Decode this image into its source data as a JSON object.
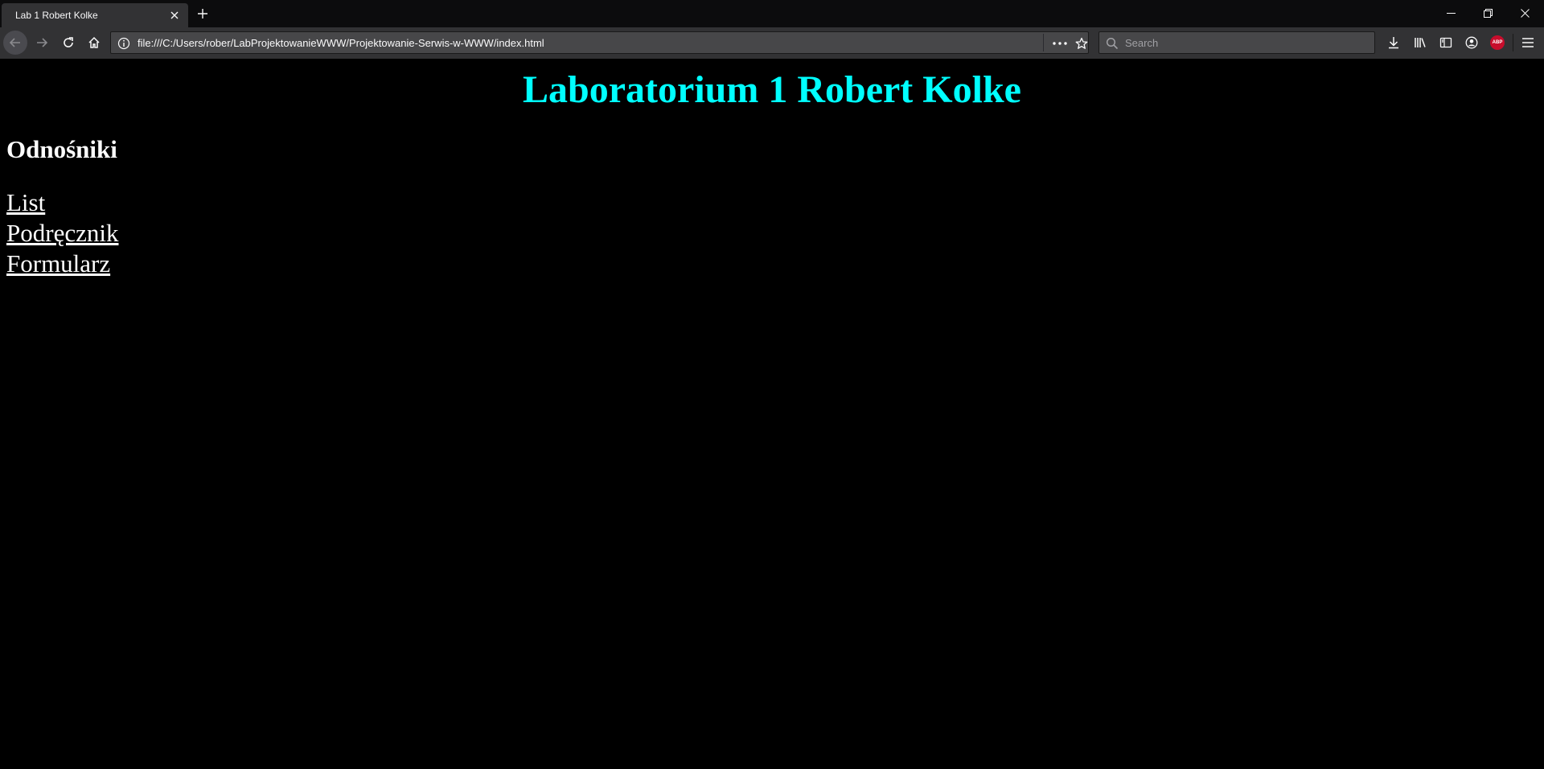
{
  "browser": {
    "tab": {
      "title": "Lab 1 Robert Kolke"
    },
    "url": "file:///C:/Users/rober/LabProjektowanieWWW/Projektowanie-Serwis-w-WWW/index.html",
    "search": {
      "placeholder": "Search"
    },
    "extension_badge": "ABP",
    "icons": [
      "close-icon",
      "plus-icon",
      "minimize-icon",
      "restore-icon",
      "back-icon",
      "forward-icon",
      "reload-icon",
      "home-icon",
      "info-icon",
      "more-icon",
      "star-icon",
      "search-icon",
      "download-icon",
      "library-icon",
      "sidebar-icon",
      "account-icon",
      "adblock-icon",
      "menu-icon"
    ]
  },
  "page": {
    "title": "Laboratorium 1 Robert Kolke",
    "heading": "Odnośniki",
    "links": [
      {
        "label": "List"
      },
      {
        "label": "Podręcznik"
      },
      {
        "label": "Formularz"
      }
    ]
  },
  "colors": {
    "title": "#00ffff",
    "background": "#000000",
    "text": "#ffffff",
    "toolbar": "#323234",
    "tabstrip": "#0c0c0d",
    "adblock": "#c70d2c"
  }
}
